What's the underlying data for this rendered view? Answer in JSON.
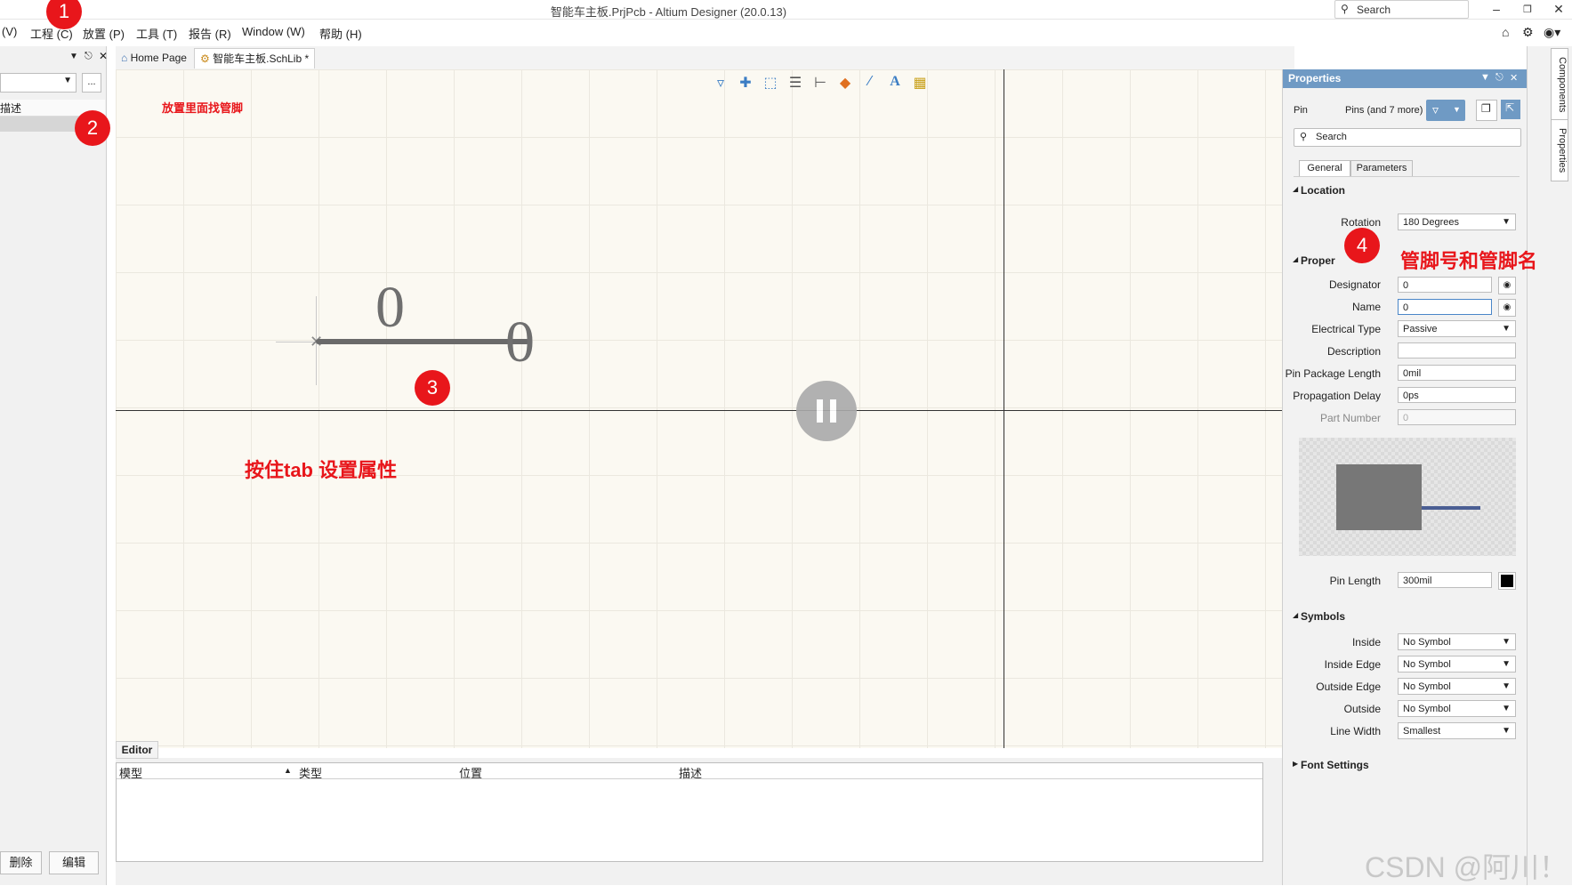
{
  "window": {
    "title": "智能车主板.PrjPcb - Altium Designer (20.0.13)",
    "search_placeholder": "Search"
  },
  "menu": {
    "items": [
      "(V)",
      "工程 (C)",
      "放置 (P)",
      "工具 (T)",
      "报告 (R)",
      "Window (W)",
      "帮助 (H)"
    ]
  },
  "left_panel": {
    "header_text": "描述",
    "dots_label": "...",
    "delete_button": "删除",
    "edit_button": "编辑"
  },
  "doc_tabs": {
    "home": "Home Page",
    "schlib": "智能车主板.SchLib *"
  },
  "canvas": {
    "designator_text": "0",
    "name_text": "0"
  },
  "editor": {
    "tab_label": "Editor",
    "columns": [
      "模型",
      "类型",
      "位置",
      "描述"
    ]
  },
  "properties": {
    "title": "Properties",
    "object_type": "Pin",
    "selection": "Pins (and 7 more)",
    "search_placeholder": "Search",
    "tabs": [
      "General",
      "Parameters"
    ],
    "sections": {
      "location": "Location",
      "properties": "Proper",
      "symbols": "Symbols",
      "font": "Font Settings"
    },
    "rotation_label": "Rotation",
    "rotation_value": "180 Degrees",
    "designator_label": "Designator",
    "designator_value": "0",
    "name_label": "Name",
    "name_value": "0",
    "electrical_type_label": "Electrical Type",
    "electrical_type_value": "Passive",
    "description_label": "Description",
    "description_value": "",
    "pin_package_length_label": "Pin Package Length",
    "pin_package_length_value": "0mil",
    "propagation_delay_label": "Propagation Delay",
    "propagation_delay_value": "0ps",
    "part_number_label": "Part Number",
    "part_number_value": "0",
    "pin_length_label": "Pin Length",
    "pin_length_value": "300mil",
    "symbols": {
      "inside_label": "Inside",
      "inside_value": "No Symbol",
      "inside_edge_label": "Inside Edge",
      "inside_edge_value": "No Symbol",
      "outside_edge_label": "Outside Edge",
      "outside_edge_value": "No Symbol",
      "outside_label": "Outside",
      "outside_value": "No Symbol",
      "line_width_label": "Line Width",
      "line_width_value": "Smallest"
    }
  },
  "side_tabs": [
    "Components",
    "Properties"
  ],
  "annotations": {
    "n1": "1",
    "n2": "2",
    "n3": "3",
    "n4": "4",
    "hint_place": "放置里面找管脚",
    "hint_tab": "按住tab 设置属性",
    "hint_pin": "管脚号和管脚名"
  },
  "watermark": "CSDN @阿川！",
  "colors": {
    "accent": "#6f9ac4",
    "annotation_red": "#e8161b",
    "canvas_bg": "#fbf9f2"
  }
}
